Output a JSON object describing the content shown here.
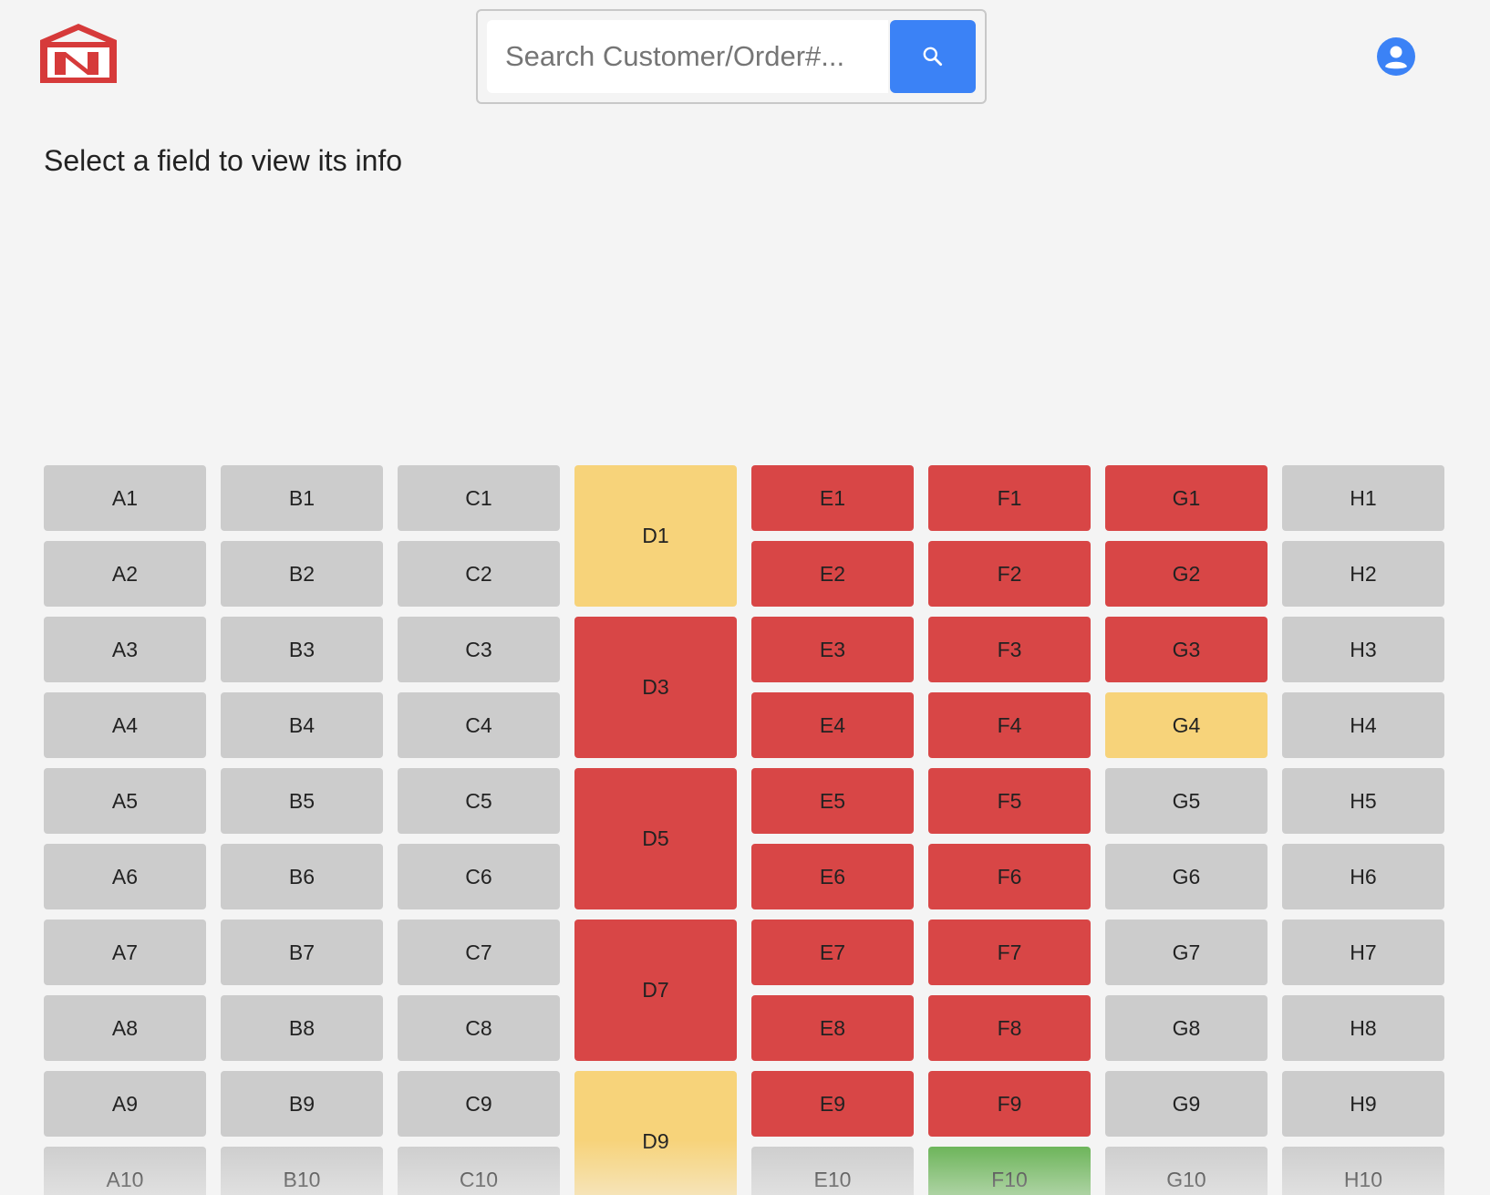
{
  "header": {
    "logo_alt": "Company logo",
    "search": {
      "placeholder": "Search Customer/Order#...",
      "value": ""
    },
    "search_button_icon": "search-icon",
    "avatar_icon": "account-circle-icon"
  },
  "prompt": "Select a field to view its info",
  "colors": {
    "grey": "#cccccc",
    "red": "#d84646",
    "yellow": "#f7d37a",
    "green": "#65b151",
    "accent": "#3b82f6",
    "logo_red": "#d63a3a"
  },
  "fields": [
    {
      "label": "A1",
      "status": "grey"
    },
    {
      "label": "A2",
      "status": "grey"
    },
    {
      "label": "A3",
      "status": "grey"
    },
    {
      "label": "A4",
      "status": "grey"
    },
    {
      "label": "A5",
      "status": "grey"
    },
    {
      "label": "A6",
      "status": "grey"
    },
    {
      "label": "A7",
      "status": "grey"
    },
    {
      "label": "A8",
      "status": "grey"
    },
    {
      "label": "A9",
      "status": "grey"
    },
    {
      "label": "A10",
      "status": "grey"
    },
    {
      "label": "B1",
      "status": "grey"
    },
    {
      "label": "B2",
      "status": "grey"
    },
    {
      "label": "B3",
      "status": "grey"
    },
    {
      "label": "B4",
      "status": "grey"
    },
    {
      "label": "B5",
      "status": "grey"
    },
    {
      "label": "B6",
      "status": "grey"
    },
    {
      "label": "B7",
      "status": "grey"
    },
    {
      "label": "B8",
      "status": "grey"
    },
    {
      "label": "B9",
      "status": "grey"
    },
    {
      "label": "B10",
      "status": "grey"
    },
    {
      "label": "C1",
      "status": "grey"
    },
    {
      "label": "C2",
      "status": "grey"
    },
    {
      "label": "C3",
      "status": "grey"
    },
    {
      "label": "C4",
      "status": "grey"
    },
    {
      "label": "C5",
      "status": "grey"
    },
    {
      "label": "C6",
      "status": "grey"
    },
    {
      "label": "C7",
      "status": "grey"
    },
    {
      "label": "C8",
      "status": "grey"
    },
    {
      "label": "C9",
      "status": "grey"
    },
    {
      "label": "C10",
      "status": "grey"
    },
    {
      "label": "D1",
      "status": "yellow",
      "span": 2
    },
    {
      "label": "D3",
      "status": "red",
      "span": 2
    },
    {
      "label": "D5",
      "status": "red",
      "span": 2
    },
    {
      "label": "D7",
      "status": "red",
      "span": 2
    },
    {
      "label": "D9",
      "status": "yellow",
      "span": 2
    },
    {
      "label": "E1",
      "status": "red"
    },
    {
      "label": "E2",
      "status": "red"
    },
    {
      "label": "E3",
      "status": "red"
    },
    {
      "label": "E4",
      "status": "red"
    },
    {
      "label": "E5",
      "status": "red"
    },
    {
      "label": "E6",
      "status": "red"
    },
    {
      "label": "E7",
      "status": "red"
    },
    {
      "label": "E8",
      "status": "red"
    },
    {
      "label": "E9",
      "status": "red"
    },
    {
      "label": "E10",
      "status": "grey"
    },
    {
      "label": "F1",
      "status": "red"
    },
    {
      "label": "F2",
      "status": "red"
    },
    {
      "label": "F3",
      "status": "red"
    },
    {
      "label": "F4",
      "status": "red"
    },
    {
      "label": "F5",
      "status": "red"
    },
    {
      "label": "F6",
      "status": "red"
    },
    {
      "label": "F7",
      "status": "red"
    },
    {
      "label": "F8",
      "status": "red"
    },
    {
      "label": "F9",
      "status": "red"
    },
    {
      "label": "F10",
      "status": "green"
    },
    {
      "label": "G1",
      "status": "red"
    },
    {
      "label": "G2",
      "status": "red"
    },
    {
      "label": "G3",
      "status": "red"
    },
    {
      "label": "G4",
      "status": "yellow"
    },
    {
      "label": "G5",
      "status": "grey"
    },
    {
      "label": "G6",
      "status": "grey"
    },
    {
      "label": "G7",
      "status": "grey"
    },
    {
      "label": "G8",
      "status": "grey"
    },
    {
      "label": "G9",
      "status": "grey"
    },
    {
      "label": "G10",
      "status": "grey"
    },
    {
      "label": "H1",
      "status": "grey"
    },
    {
      "label": "H2",
      "status": "grey"
    },
    {
      "label": "H3",
      "status": "grey"
    },
    {
      "label": "H4",
      "status": "grey"
    },
    {
      "label": "H5",
      "status": "grey"
    },
    {
      "label": "H6",
      "status": "grey"
    },
    {
      "label": "H7",
      "status": "grey"
    },
    {
      "label": "H8",
      "status": "grey"
    },
    {
      "label": "H9",
      "status": "grey"
    },
    {
      "label": "H10",
      "status": "grey"
    }
  ]
}
